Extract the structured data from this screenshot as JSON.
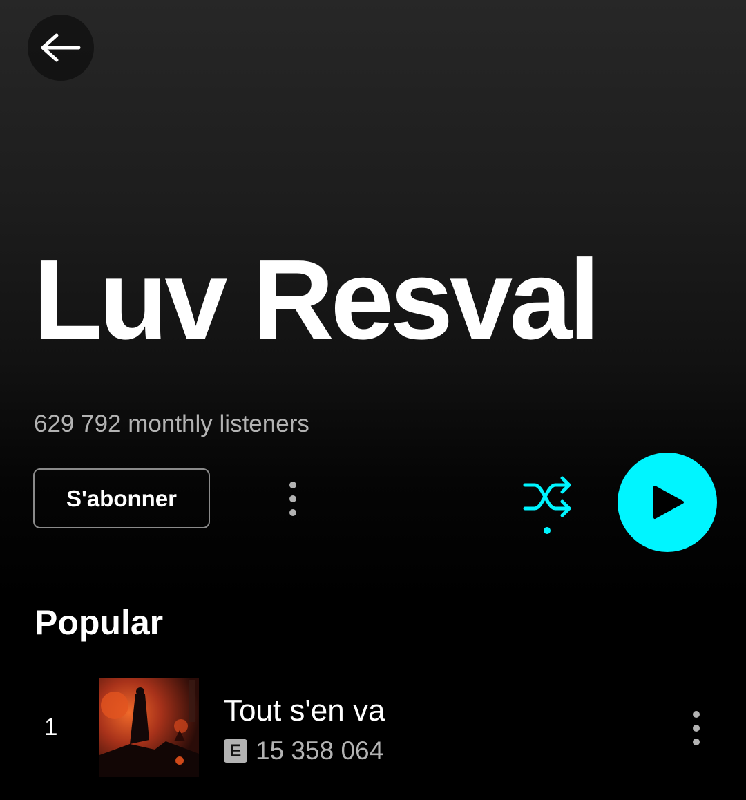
{
  "header": {
    "back_icon": "arrow-left-icon"
  },
  "artist": {
    "name": "Luv Resval",
    "monthly_listeners": "629 792 monthly listeners"
  },
  "actions": {
    "follow_label": "S'abonner",
    "more_icon": "more-vertical-icon",
    "shuffle_icon": "shuffle-icon",
    "play_icon": "play-icon",
    "accent_color": "#00f5ff"
  },
  "popular": {
    "title": "Popular",
    "tracks": [
      {
        "index": "1",
        "title": "Tout s'en va",
        "explicit": "E",
        "plays": "15 358 064"
      }
    ]
  }
}
